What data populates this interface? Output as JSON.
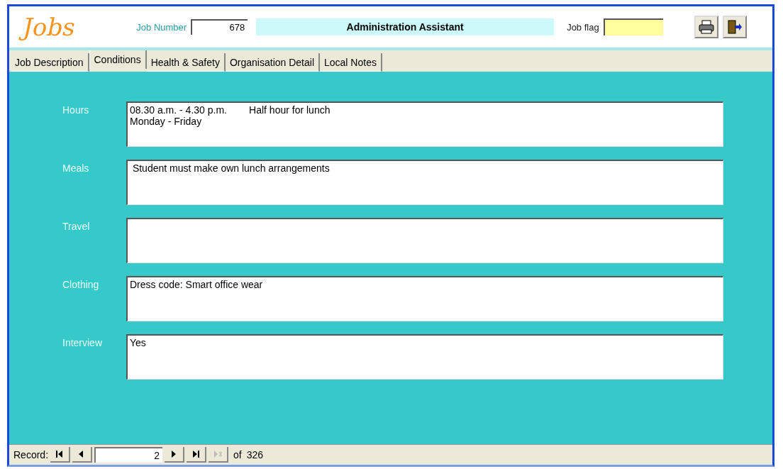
{
  "header": {
    "logo": "Jobs",
    "job_number_label": "Job Number",
    "job_number": "678",
    "job_title": "Administration Assistant",
    "job_flag_label": "Job flag"
  },
  "tabs": [
    {
      "label": "Job Description",
      "selected": false
    },
    {
      "label": "Conditions",
      "selected": true
    },
    {
      "label": "Health & Safety",
      "selected": false
    },
    {
      "label": "Organisation Detail",
      "selected": false
    },
    {
      "label": "Local Notes",
      "selected": false
    }
  ],
  "fields": [
    {
      "label": "Hours",
      "value": "08.30 a.m. - 4.30 p.m.        Half hour for lunch\nMonday - Friday"
    },
    {
      "label": "Meals",
      "value": " Student must make own lunch arrangements"
    },
    {
      "label": "Travel"
    },
    {
      "label": "Clothing",
      "value": "Dress code: Smart office wear"
    },
    {
      "label": "Interview",
      "value": "Yes"
    }
  ],
  "record_nav": {
    "label": "Record:",
    "current": "2",
    "of_label": "of",
    "total": "326",
    "buttons": [
      {
        "kind": "first",
        "disabled": false
      },
      {
        "kind": "prev",
        "disabled": false
      },
      {
        "kind": "next",
        "disabled": false
      },
      {
        "kind": "last",
        "disabled": false
      },
      {
        "kind": "new",
        "disabled": true
      }
    ]
  }
}
